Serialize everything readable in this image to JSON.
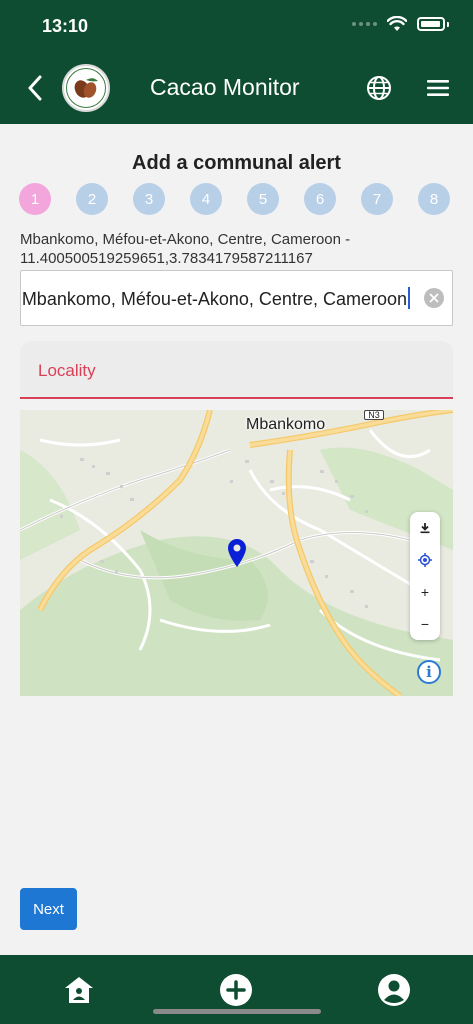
{
  "status_bar": {
    "time": "13:10"
  },
  "header": {
    "title": "Cacao Monitor",
    "logo_text": "COCOA TRUST"
  },
  "page": {
    "title": "Add a communal alert"
  },
  "steps": [
    "1",
    "2",
    "3",
    "4",
    "5",
    "6",
    "7",
    "8"
  ],
  "active_step": "1",
  "location": {
    "description": "Mbankomo, Méfou-et-Akono, Centre, Cameroon - 11.400500519259651,3.7834179587211167"
  },
  "search": {
    "value": "Mbankomo, Méfou-et-Akono, Centre, Cameroon"
  },
  "locality": {
    "label": "Locality"
  },
  "map": {
    "town_label": "Mbankomo",
    "road_badge": "N3",
    "controls": {
      "zoom_in": "+",
      "zoom_out": "−",
      "info": "i"
    }
  },
  "actions": {
    "next_label": "Next"
  },
  "colors": {
    "header": "#0e4d32",
    "accent": "#1e77d3",
    "step_active": "#f2a6dc",
    "step_inactive": "#b8cfe8",
    "locality": "#d94057",
    "pin": "#0a1fd6"
  },
  "icons": {
    "back": "chevron-left-icon",
    "globe": "globe-icon",
    "menu": "hamburger-menu-icon",
    "clear": "clear-circle-icon",
    "download": "download-icon",
    "locate": "gps-target-icon",
    "pin": "map-pin-icon",
    "home": "home-icon",
    "add": "add-circle-icon",
    "profile": "user-circle-icon"
  }
}
